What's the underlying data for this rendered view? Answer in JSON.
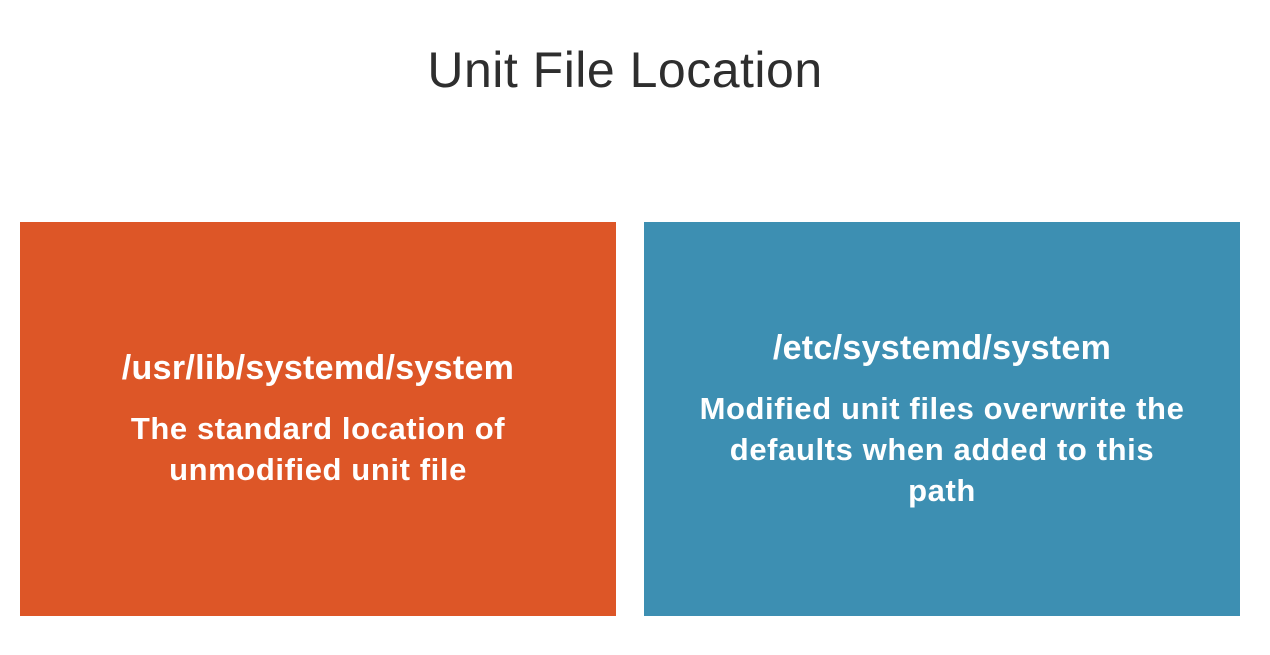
{
  "slide": {
    "title": "Unit File Location"
  },
  "panels": [
    {
      "path": "/usr/lib/systemd/system",
      "description": "The standard location of unmodified unit file",
      "color": "#dd5627"
    },
    {
      "path": "/etc/systemd/system",
      "description": "Modified unit files overwrite the defaults when added to this path",
      "color": "#3d8fb2"
    }
  ]
}
